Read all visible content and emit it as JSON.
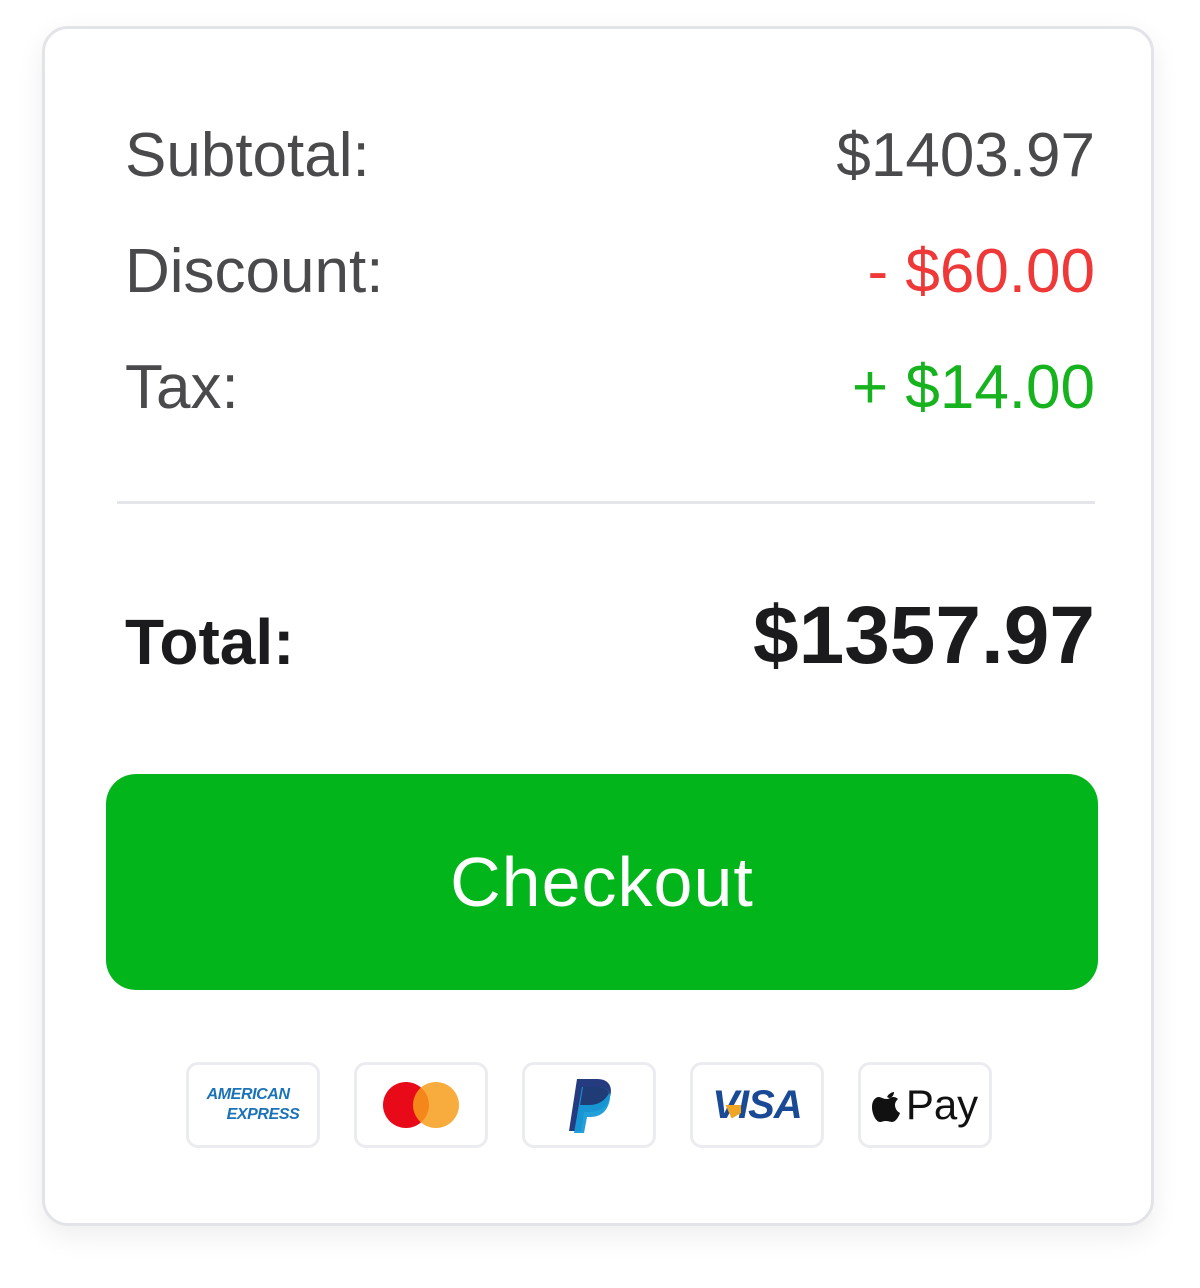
{
  "summary": {
    "subtotal": {
      "label": "Subtotal:",
      "value": "$1403.97"
    },
    "discount": {
      "label": "Discount:",
      "value": "- $60.00"
    },
    "tax": {
      "label": "Tax:",
      "value": "+ $14.00"
    },
    "total": {
      "label": "Total:",
      "value": "$1357.97"
    }
  },
  "checkout": {
    "label": "Checkout",
    "color": "#02b51a"
  },
  "colors": {
    "discount": "#ef3838",
    "tax": "#16b31e",
    "text": "#4a4a4d",
    "total": "#1b1b1d"
  },
  "payment_methods": {
    "amex": {
      "line1": "AMERICAN",
      "line2": "EXPRESS",
      "icon": "american-express-icon"
    },
    "mastercard": {
      "icon": "mastercard-icon"
    },
    "paypal": {
      "icon": "paypal-icon"
    },
    "visa": {
      "label": "VISA",
      "icon": "visa-icon"
    },
    "applepay": {
      "label": "Pay",
      "icon": "apple-pay-icon"
    }
  }
}
